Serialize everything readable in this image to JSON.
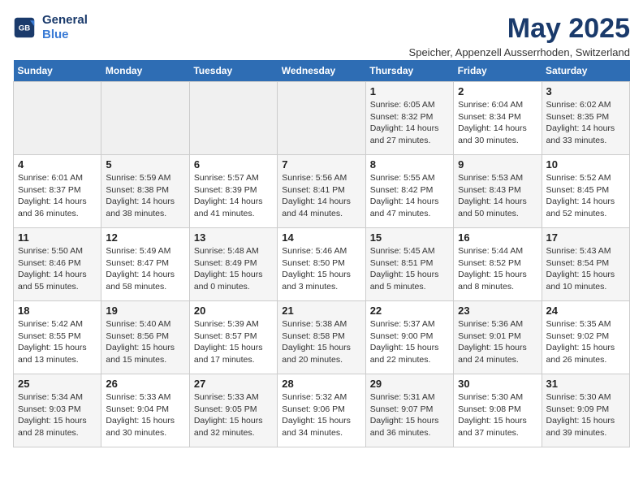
{
  "logo": {
    "line1": "General",
    "line2": "Blue"
  },
  "title": "May 2025",
  "subtitle": "Speicher, Appenzell Ausserrhoden, Switzerland",
  "headers": [
    "Sunday",
    "Monday",
    "Tuesday",
    "Wednesday",
    "Thursday",
    "Friday",
    "Saturday"
  ],
  "weeks": [
    [
      {
        "day": "",
        "info": "",
        "empty": true
      },
      {
        "day": "",
        "info": "",
        "empty": true
      },
      {
        "day": "",
        "info": "",
        "empty": true
      },
      {
        "day": "",
        "info": "",
        "empty": true
      },
      {
        "day": "1",
        "info": "Sunrise: 6:05 AM\nSunset: 8:32 PM\nDaylight: 14 hours\nand 27 minutes.",
        "empty": false
      },
      {
        "day": "2",
        "info": "Sunrise: 6:04 AM\nSunset: 8:34 PM\nDaylight: 14 hours\nand 30 minutes.",
        "empty": false
      },
      {
        "day": "3",
        "info": "Sunrise: 6:02 AM\nSunset: 8:35 PM\nDaylight: 14 hours\nand 33 minutes.",
        "empty": false
      }
    ],
    [
      {
        "day": "4",
        "info": "Sunrise: 6:01 AM\nSunset: 8:37 PM\nDaylight: 14 hours\nand 36 minutes.",
        "empty": false
      },
      {
        "day": "5",
        "info": "Sunrise: 5:59 AM\nSunset: 8:38 PM\nDaylight: 14 hours\nand 38 minutes.",
        "empty": false
      },
      {
        "day": "6",
        "info": "Sunrise: 5:57 AM\nSunset: 8:39 PM\nDaylight: 14 hours\nand 41 minutes.",
        "empty": false
      },
      {
        "day": "7",
        "info": "Sunrise: 5:56 AM\nSunset: 8:41 PM\nDaylight: 14 hours\nand 44 minutes.",
        "empty": false
      },
      {
        "day": "8",
        "info": "Sunrise: 5:55 AM\nSunset: 8:42 PM\nDaylight: 14 hours\nand 47 minutes.",
        "empty": false
      },
      {
        "day": "9",
        "info": "Sunrise: 5:53 AM\nSunset: 8:43 PM\nDaylight: 14 hours\nand 50 minutes.",
        "empty": false
      },
      {
        "day": "10",
        "info": "Sunrise: 5:52 AM\nSunset: 8:45 PM\nDaylight: 14 hours\nand 52 minutes.",
        "empty": false
      }
    ],
    [
      {
        "day": "11",
        "info": "Sunrise: 5:50 AM\nSunset: 8:46 PM\nDaylight: 14 hours\nand 55 minutes.",
        "empty": false
      },
      {
        "day": "12",
        "info": "Sunrise: 5:49 AM\nSunset: 8:47 PM\nDaylight: 14 hours\nand 58 minutes.",
        "empty": false
      },
      {
        "day": "13",
        "info": "Sunrise: 5:48 AM\nSunset: 8:49 PM\nDaylight: 15 hours\nand 0 minutes.",
        "empty": false
      },
      {
        "day": "14",
        "info": "Sunrise: 5:46 AM\nSunset: 8:50 PM\nDaylight: 15 hours\nand 3 minutes.",
        "empty": false
      },
      {
        "day": "15",
        "info": "Sunrise: 5:45 AM\nSunset: 8:51 PM\nDaylight: 15 hours\nand 5 minutes.",
        "empty": false
      },
      {
        "day": "16",
        "info": "Sunrise: 5:44 AM\nSunset: 8:52 PM\nDaylight: 15 hours\nand 8 minutes.",
        "empty": false
      },
      {
        "day": "17",
        "info": "Sunrise: 5:43 AM\nSunset: 8:54 PM\nDaylight: 15 hours\nand 10 minutes.",
        "empty": false
      }
    ],
    [
      {
        "day": "18",
        "info": "Sunrise: 5:42 AM\nSunset: 8:55 PM\nDaylight: 15 hours\nand 13 minutes.",
        "empty": false
      },
      {
        "day": "19",
        "info": "Sunrise: 5:40 AM\nSunset: 8:56 PM\nDaylight: 15 hours\nand 15 minutes.",
        "empty": false
      },
      {
        "day": "20",
        "info": "Sunrise: 5:39 AM\nSunset: 8:57 PM\nDaylight: 15 hours\nand 17 minutes.",
        "empty": false
      },
      {
        "day": "21",
        "info": "Sunrise: 5:38 AM\nSunset: 8:58 PM\nDaylight: 15 hours\nand 20 minutes.",
        "empty": false
      },
      {
        "day": "22",
        "info": "Sunrise: 5:37 AM\nSunset: 9:00 PM\nDaylight: 15 hours\nand 22 minutes.",
        "empty": false
      },
      {
        "day": "23",
        "info": "Sunrise: 5:36 AM\nSunset: 9:01 PM\nDaylight: 15 hours\nand 24 minutes.",
        "empty": false
      },
      {
        "day": "24",
        "info": "Sunrise: 5:35 AM\nSunset: 9:02 PM\nDaylight: 15 hours\nand 26 minutes.",
        "empty": false
      }
    ],
    [
      {
        "day": "25",
        "info": "Sunrise: 5:34 AM\nSunset: 9:03 PM\nDaylight: 15 hours\nand 28 minutes.",
        "empty": false
      },
      {
        "day": "26",
        "info": "Sunrise: 5:33 AM\nSunset: 9:04 PM\nDaylight: 15 hours\nand 30 minutes.",
        "empty": false
      },
      {
        "day": "27",
        "info": "Sunrise: 5:33 AM\nSunset: 9:05 PM\nDaylight: 15 hours\nand 32 minutes.",
        "empty": false
      },
      {
        "day": "28",
        "info": "Sunrise: 5:32 AM\nSunset: 9:06 PM\nDaylight: 15 hours\nand 34 minutes.",
        "empty": false
      },
      {
        "day": "29",
        "info": "Sunrise: 5:31 AM\nSunset: 9:07 PM\nDaylight: 15 hours\nand 36 minutes.",
        "empty": false
      },
      {
        "day": "30",
        "info": "Sunrise: 5:30 AM\nSunset: 9:08 PM\nDaylight: 15 hours\nand 37 minutes.",
        "empty": false
      },
      {
        "day": "31",
        "info": "Sunrise: 5:30 AM\nSunset: 9:09 PM\nDaylight: 15 hours\nand 39 minutes.",
        "empty": false
      }
    ]
  ]
}
